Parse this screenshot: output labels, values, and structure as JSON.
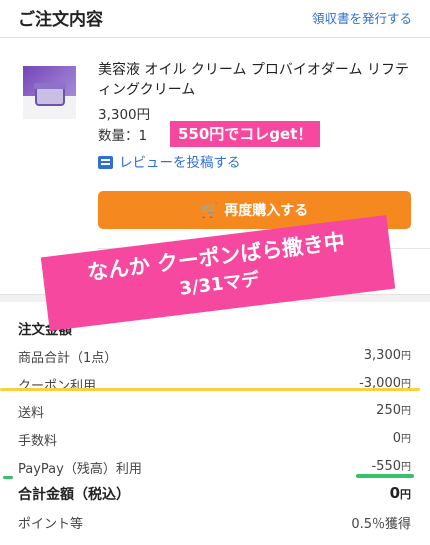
{
  "header": {
    "title": "ご注文内容",
    "receipt_link": "領収書を発行する"
  },
  "product": {
    "name": "美容液 オイル クリーム プロバイオダーム リフティングクリーム",
    "price": "3,300円",
    "quantity": "数量：1"
  },
  "sticker_top": "550円でコレget！",
  "review_link": "レビューを投稿する",
  "rebuy_button": "再度購入する",
  "sticker_big": {
    "line1": "なんか クーポンばら撒き中",
    "line2": "3/31マデ"
  },
  "summary": {
    "title": "注文金額",
    "rows": [
      {
        "label": "商品合計（1点）",
        "value": "3,300",
        "unit": "円"
      },
      {
        "label": "クーポン利用",
        "value": "-3,000",
        "unit": "円"
      },
      {
        "label": "送料",
        "value": "250",
        "unit": "円"
      },
      {
        "label": "手数料",
        "value": "0",
        "unit": "円"
      },
      {
        "label": "PayPay（残高）利用",
        "value": "-550",
        "unit": "円"
      }
    ],
    "total_label": "合計金額（税込）",
    "total_value": "0",
    "total_unit": "円",
    "points_label": "ポイント等",
    "points_value": "0.5％獲得"
  },
  "colors": {
    "link": "#2f6fd6",
    "button": "#f5891f",
    "sticker": "#f5489e",
    "highlight_yellow": "#f7d23a",
    "highlight_green": "#37c26a"
  }
}
